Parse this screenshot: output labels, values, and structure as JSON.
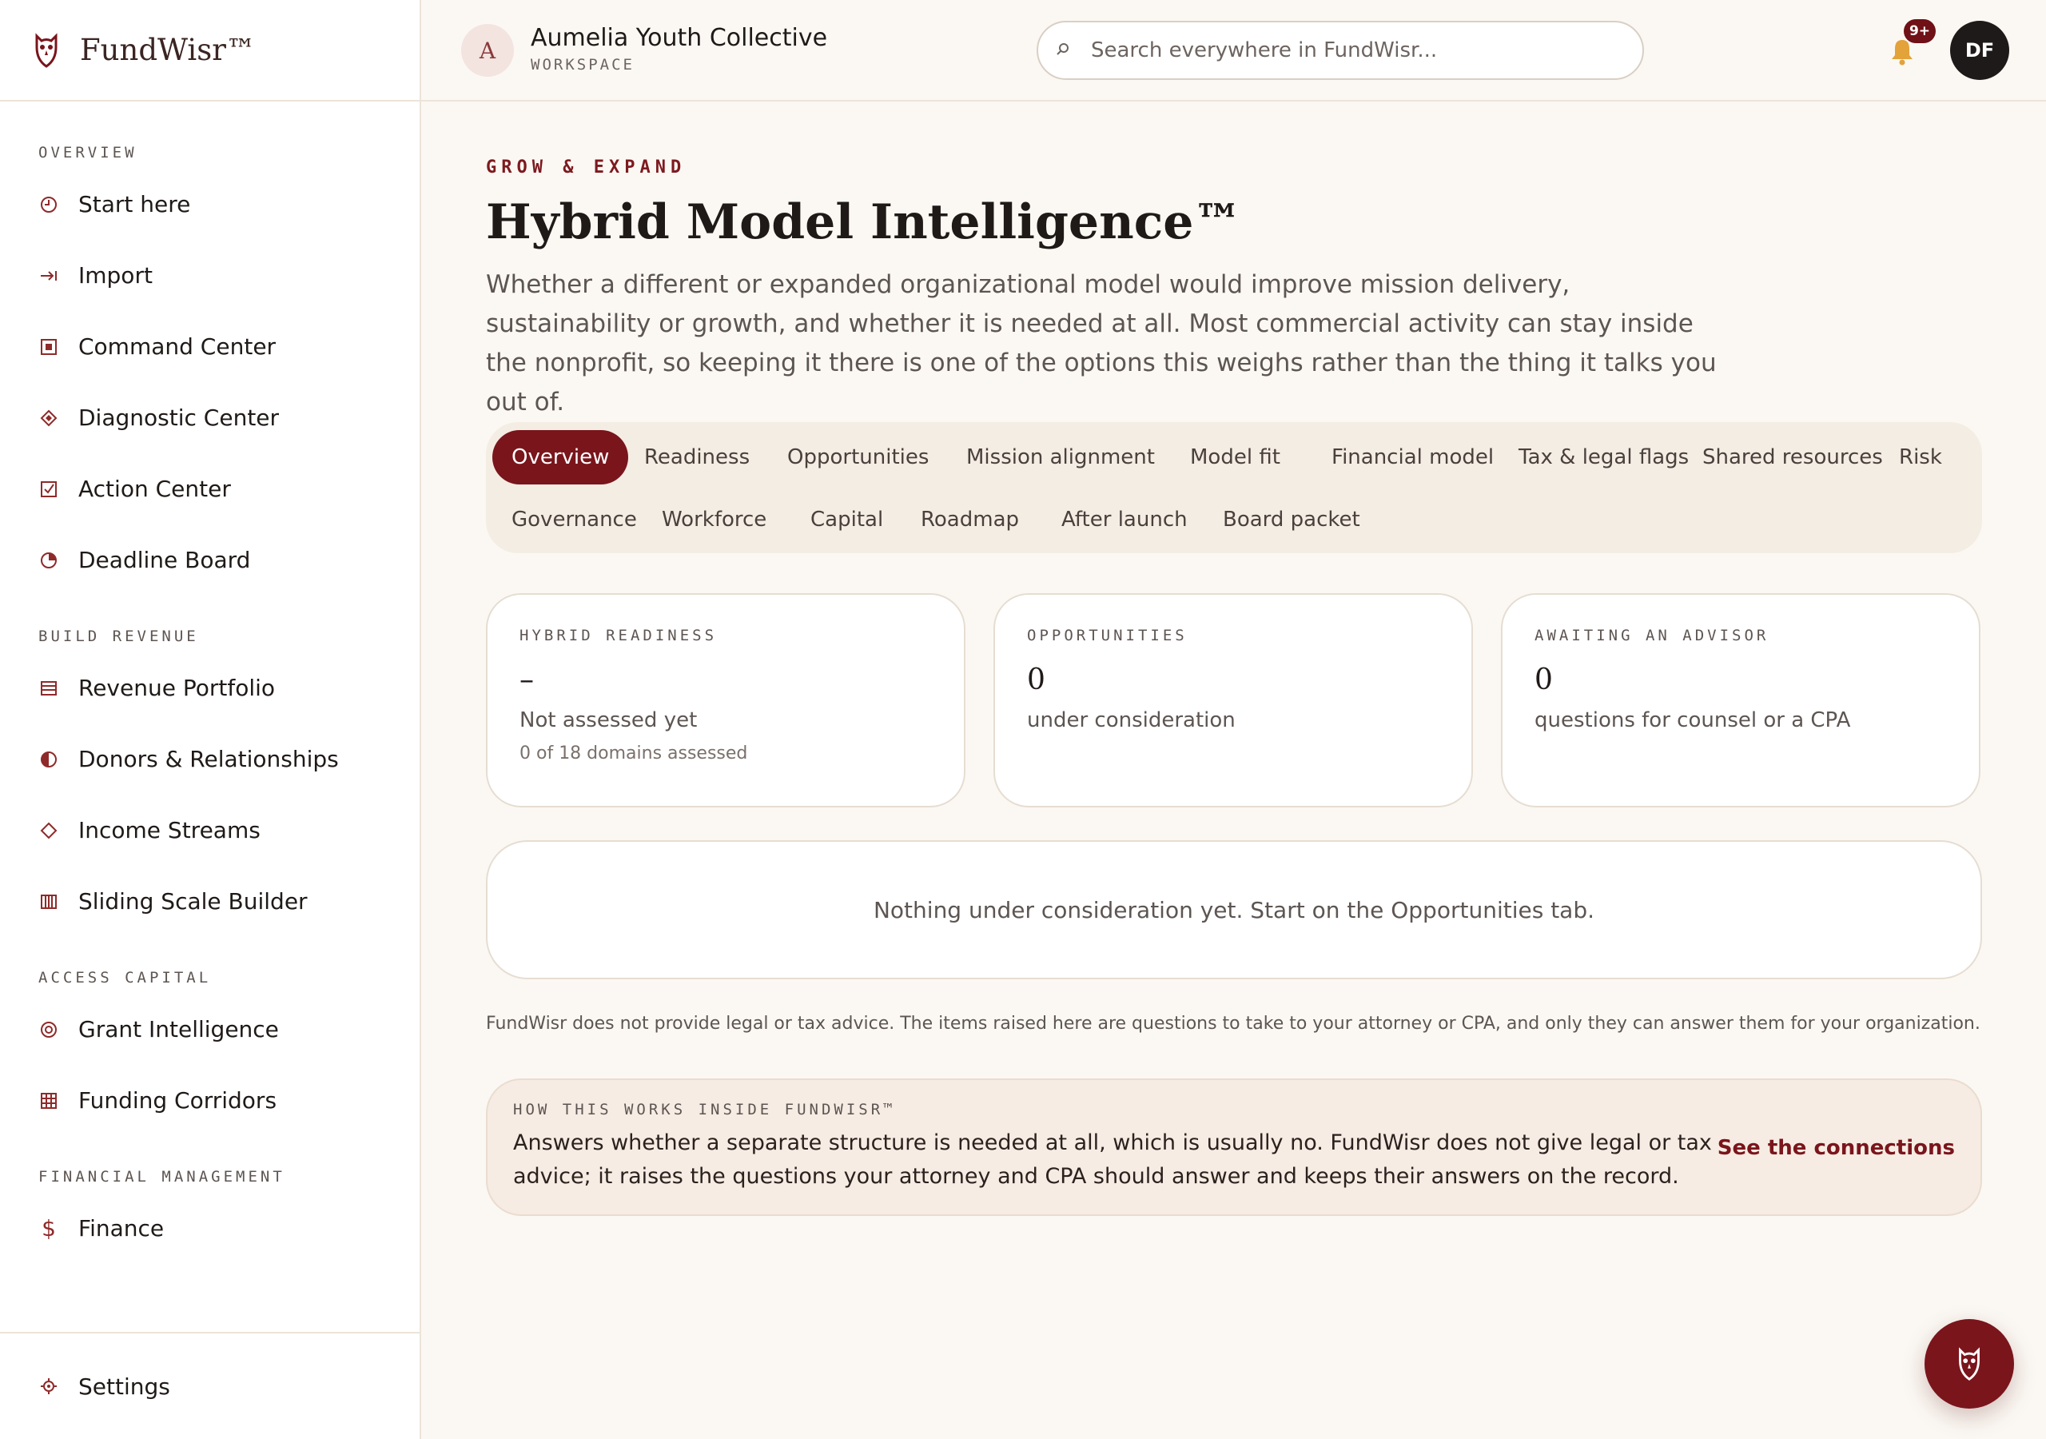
{
  "brand": {
    "name": "FundWisr™",
    "logo_icon": "owl-icon"
  },
  "workspace": {
    "initial": "A",
    "name": "Aumelia Youth Collective",
    "label": "WORKSPACE"
  },
  "search": {
    "placeholder": "Search everywhere in FundWisr..."
  },
  "notifications": {
    "badge": "9+",
    "icon": "bell-icon"
  },
  "user": {
    "initials": "DF"
  },
  "sidebar": {
    "sections": [
      {
        "title": "OVERVIEW",
        "items": [
          {
            "label": "Start here",
            "icon": "clock-icon"
          },
          {
            "label": "Import",
            "icon": "import-arrow-icon"
          },
          {
            "label": "Command Center",
            "icon": "square-target-icon"
          },
          {
            "label": "Diagnostic Center",
            "icon": "diamond-icon"
          },
          {
            "label": "Action Center",
            "icon": "checkbox-icon"
          },
          {
            "label": "Deadline Board",
            "icon": "pie-clock-icon"
          }
        ]
      },
      {
        "title": "BUILD REVENUE",
        "items": [
          {
            "label": "Revenue Portfolio",
            "icon": "list-icon"
          },
          {
            "label": "Donors & Relationships",
            "icon": "half-circle-icon"
          },
          {
            "label": "Income Streams",
            "icon": "diamond-outline-icon"
          },
          {
            "label": "Sliding Scale Builder",
            "icon": "columns-icon"
          }
        ]
      },
      {
        "title": "ACCESS CAPITAL",
        "items": [
          {
            "label": "Grant Intelligence",
            "icon": "target-icon"
          },
          {
            "label": "Funding Corridors",
            "icon": "grid-icon"
          }
        ]
      },
      {
        "title": "FINANCIAL MANAGEMENT",
        "items": [
          {
            "label": "Finance",
            "icon": "dollar-icon"
          }
        ]
      }
    ],
    "settings": {
      "label": "Settings",
      "icon": "gear-icon"
    }
  },
  "page": {
    "eyebrow": "GROW & EXPAND",
    "title": "Hybrid Model Intelligence™",
    "lead": "Whether a different or expanded organizational model would improve mission delivery, sustainability or growth, and whether it is needed at all. Most commercial activity can stay inside the nonprofit, so keeping it there is one of the options this weighs rather than the thing it talks you out of."
  },
  "tabs": [
    "Overview",
    "Readiness",
    "Opportunities",
    "Mission alignment",
    "Model fit",
    "Financial model",
    "Tax & legal flags",
    "Shared resources",
    "Risk",
    "Governance",
    "Workforce",
    "Capital",
    "Roadmap",
    "After launch",
    "Board packet"
  ],
  "active_tab": "Overview",
  "cards": [
    {
      "label": "HYBRID READINESS",
      "value": "–",
      "desc": "Not assessed yet",
      "sub": "0 of 18 domains assessed"
    },
    {
      "label": "OPPORTUNITIES",
      "value": "0",
      "desc": "under consideration",
      "sub": ""
    },
    {
      "label": "AWAITING AN ADVISOR",
      "value": "0",
      "desc": "questions for counsel or a CPA",
      "sub": ""
    }
  ],
  "empty_state": "Nothing under consideration yet. Start on the Opportunities tab.",
  "disclaimer": "FundWisr does not provide legal or tax advice. The items raised here are questions to take to your attorney or CPA, and only they can answer them for your organization.",
  "how_it_works": {
    "label": "HOW THIS WORKS INSIDE FUNDWISR™",
    "text": "Answers whether a separate structure is needed at all, which is usually no. FundWisr does not give legal or tax advice; it raises the questions your attorney and CPA should answer and keeps their answers on the record.",
    "link": "See the connections"
  },
  "colors": {
    "accent": "#7a151c",
    "background": "#fbf8f3",
    "icon": "#8f2a2a"
  }
}
